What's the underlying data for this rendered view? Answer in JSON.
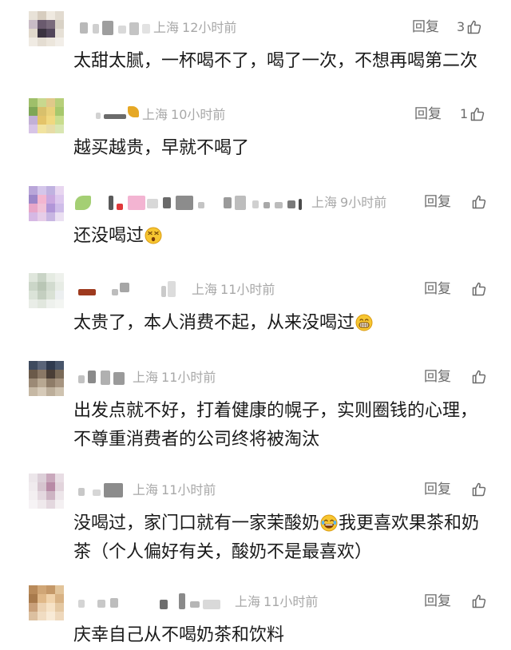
{
  "comments": [
    {
      "location": "上海",
      "time": "12小时前",
      "reply": "回复",
      "likes": "3",
      "lines": [
        "太甜太腻，一杯喝不了，喝了一次，不想再喝第二次"
      ]
    },
    {
      "location": "上海",
      "time": "10小时前",
      "reply": "回复",
      "likes": "1",
      "lines": [
        "越买越贵，早就不喝了"
      ]
    },
    {
      "location": "上海",
      "time": "9小时前",
      "reply": "回复",
      "likes": "",
      "lines": [
        "还没喝过"
      ]
    },
    {
      "location": "上海",
      "time": "11小时前",
      "reply": "回复",
      "likes": "",
      "lines": [
        "太贵了，本人消费不起，从来没喝过"
      ]
    },
    {
      "location": "上海",
      "time": "11小时前",
      "reply": "回复",
      "likes": "",
      "lines": [
        "出发点就不好，打着健康的幌子，实则圈钱的心理，",
        "不尊重消费者的公司终将被淘汰"
      ]
    },
    {
      "location": "上海",
      "time": "11小时前",
      "reply": "回复",
      "likes": "",
      "lines": [
        "没喝过，家门口就有一家茉酸奶",
        "我更喜欢果茶和奶",
        "茶（个人偏好有关，酸奶不是最喜欢）"
      ]
    },
    {
      "location": "上海",
      "time": "11小时前",
      "reply": "回复",
      "likes": "",
      "lines": [
        "庆幸自己从不喝奶茶和饮料"
      ]
    }
  ],
  "icons": {
    "like": "thumbs-up-icon",
    "emoji_3": "dizzy-face-emoji-icon",
    "emoji_4": "grinning-teeth-emoji-icon",
    "emoji_6": "laughing-tears-emoji-icon"
  },
  "colors": {
    "text": "#1a1a1a",
    "meta": "#a8a8a8",
    "action": "#6b6b6b"
  }
}
